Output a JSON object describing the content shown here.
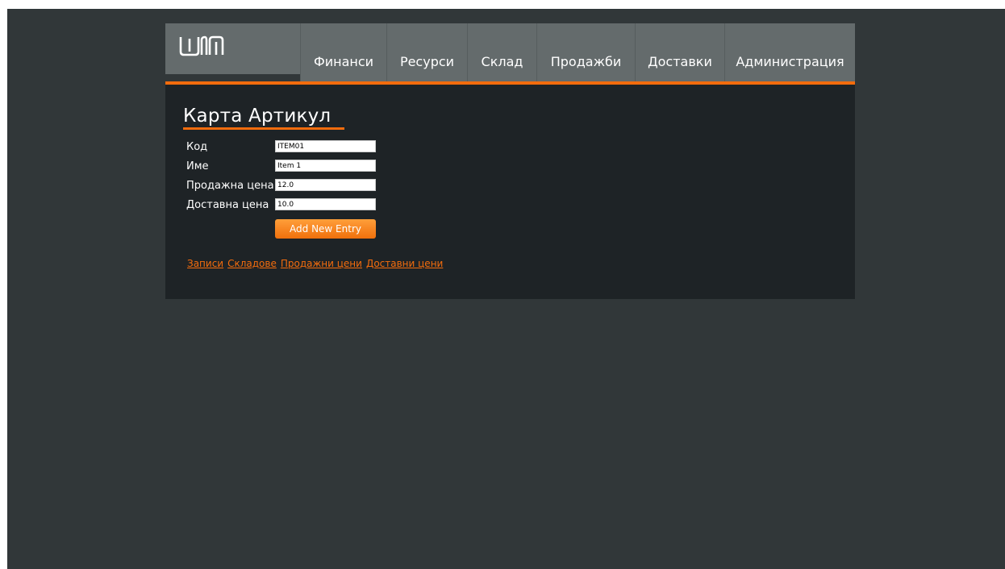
{
  "nav": {
    "items": [
      {
        "label": "Финанси"
      },
      {
        "label": "Ресурси"
      },
      {
        "label": "Склад"
      },
      {
        "label": "Продажби"
      },
      {
        "label": "Доставки"
      },
      {
        "label": "Администрация"
      }
    ]
  },
  "page": {
    "title": "Карта Артикул"
  },
  "form": {
    "code": {
      "label": "Код",
      "value": "ITEM01"
    },
    "name": {
      "label": "Име",
      "value": "Item 1"
    },
    "sale_price": {
      "label": "Продажна цена",
      "value": "12.0"
    },
    "delivery_price": {
      "label": "Доставна цена",
      "value": "10.0"
    },
    "add_label": "Add New Entry"
  },
  "links": [
    {
      "label": "Записи"
    },
    {
      "label": "Складове"
    },
    {
      "label": "Продажни цени"
    },
    {
      "label": "Доставни цени"
    }
  ],
  "colors": {
    "accent": "#f36c0d",
    "background": "#313739",
    "panel": "#1e2326",
    "nav": "#646b6c"
  },
  "icons": {
    "logo": "wim-logo"
  }
}
